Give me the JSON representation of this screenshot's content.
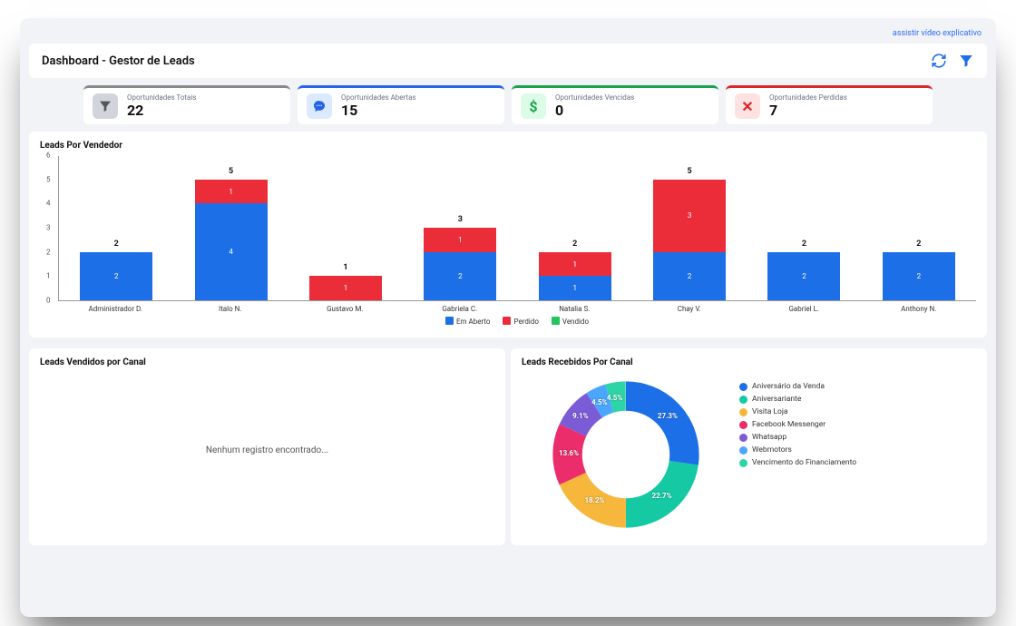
{
  "video_link": "assistir vídeo explicativo",
  "page_title": "Dashboard - Gestor de Leads",
  "cards": [
    {
      "label": "Oportunidades Totais",
      "value": "22"
    },
    {
      "label": "Oportunidades Abertas",
      "value": "15"
    },
    {
      "label": "Oportunidades Vencidas",
      "value": "0"
    },
    {
      "label": "Oportunidades Perdidas",
      "value": "7"
    }
  ],
  "bar_panel_title": "Leads Por Vendedor",
  "bar_legend": {
    "open": "Em Aberto",
    "lost": "Perdido",
    "sold": "Vendido"
  },
  "sold_panel_title": "Leads Vendidos por Canal",
  "sold_empty_msg": "Nenhum registro encontrado...",
  "received_panel_title": "Leads Recebidos Por Canal",
  "chart_data": {
    "bar": {
      "type": "bar",
      "title": "Leads Por Vendedor",
      "ylabel": "",
      "ylim": [
        0,
        6
      ],
      "yticks": [
        0,
        1,
        2,
        3,
        4,
        5,
        6
      ],
      "categories": [
        "Administrador D.",
        "Italo N.",
        "Gustavo M.",
        "Gabriela C.",
        "Natalia S.",
        "Chay V.",
        "Gabriel L.",
        "Anthony N."
      ],
      "series": [
        {
          "name": "Em Aberto",
          "color": "#1d6fe8",
          "values": [
            2,
            4,
            0,
            2,
            1,
            2,
            2,
            2
          ]
        },
        {
          "name": "Perdido",
          "color": "#eb2d3a",
          "values": [
            0,
            1,
            1,
            1,
            1,
            3,
            0,
            0
          ]
        },
        {
          "name": "Vendido",
          "color": "#22c55e",
          "values": [
            0,
            0,
            0,
            0,
            0,
            0,
            0,
            0
          ]
        }
      ],
      "totals": [
        2,
        5,
        1,
        3,
        2,
        5,
        2,
        2
      ]
    },
    "donut": {
      "type": "pie",
      "title": "Leads Recebidos Por Canal",
      "series": [
        {
          "name": "Aniversário da Venda",
          "pct": 27.3,
          "color": "#1d6fe8"
        },
        {
          "name": "Aniversariante",
          "pct": 22.7,
          "color": "#14c9a3"
        },
        {
          "name": "Visita Loja",
          "pct": 18.2,
          "color": "#f6b73c"
        },
        {
          "name": "Facebook Messenger",
          "pct": 13.6,
          "color": "#eb2d6b"
        },
        {
          "name": "Whatsapp",
          "pct": 9.1,
          "color": "#7c5bd6"
        },
        {
          "name": "Webmotors",
          "pct": 4.5,
          "color": "#4aa6ff"
        },
        {
          "name": "Vencimento do Financiamento",
          "pct": 4.5,
          "color": "#2dd4a7"
        }
      ]
    }
  }
}
